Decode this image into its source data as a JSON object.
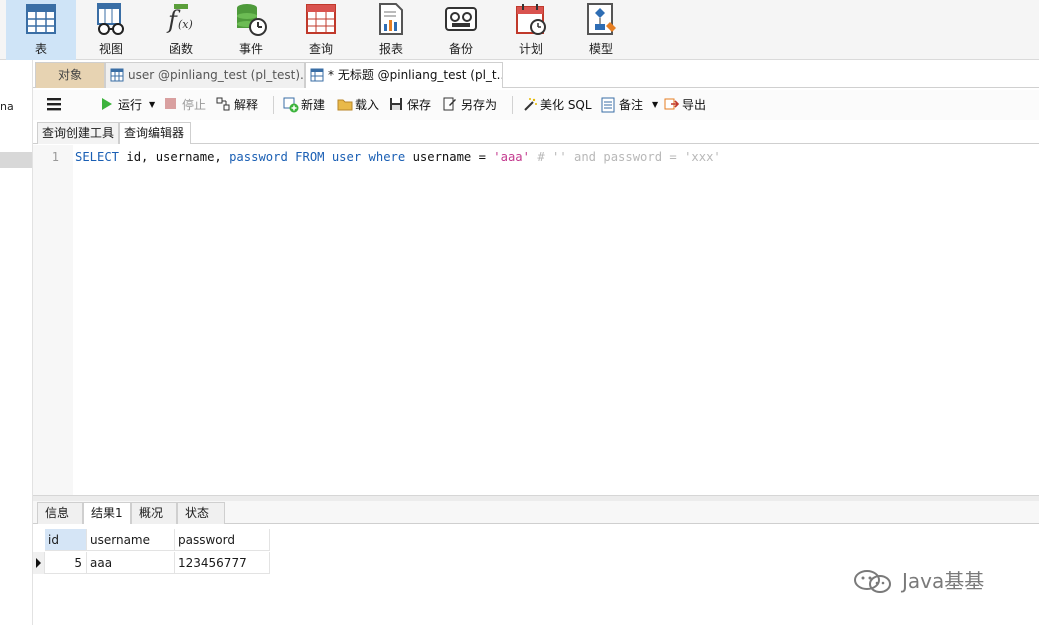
{
  "ribbon": {
    "items": [
      {
        "label": "表",
        "icon": "table-icon"
      },
      {
        "label": "视图",
        "icon": "view-icon"
      },
      {
        "label": "函数",
        "icon": "function-icon"
      },
      {
        "label": "事件",
        "icon": "event-icon"
      },
      {
        "label": "查询",
        "icon": "query-icon"
      },
      {
        "label": "报表",
        "icon": "report-icon"
      },
      {
        "label": "备份",
        "icon": "backup-icon"
      },
      {
        "label": "计划",
        "icon": "schedule-icon"
      },
      {
        "label": "模型",
        "icon": "model-icon"
      }
    ],
    "active_label": "表"
  },
  "left_panel": {
    "fragment_text": "na"
  },
  "doc_tabs": {
    "objects": "对象",
    "tab1": "user @pinliang_test (pl_test)...",
    "tab2": "* 无标题 @pinliang_test (pl_t..."
  },
  "toolbar": {
    "run": "运行",
    "stop": "停止",
    "explain": "解释",
    "new": "新建",
    "load": "载入",
    "save": "保存",
    "save_as": "另存为",
    "beautify": "美化 SQL",
    "note": "备注",
    "export": "导出"
  },
  "sub_tabs": {
    "builder": "查询创建工具",
    "editor": "查询编辑器"
  },
  "editor": {
    "line_number": "1",
    "tokens": [
      {
        "t": "SELECT",
        "c": "kw"
      },
      {
        "t": " id, username, ",
        "c": ""
      },
      {
        "t": "password",
        "c": "kw"
      },
      {
        "t": " ",
        "c": ""
      },
      {
        "t": "FROM",
        "c": "kw"
      },
      {
        "t": " ",
        "c": ""
      },
      {
        "t": "user",
        "c": "kw"
      },
      {
        "t": " ",
        "c": ""
      },
      {
        "t": "where",
        "c": "kw"
      },
      {
        "t": " username = ",
        "c": ""
      },
      {
        "t": "'aaa'",
        "c": "str"
      },
      {
        "t": " # '' and password = 'xxx'",
        "c": "cmt"
      }
    ]
  },
  "result_tabs": {
    "info": "信息",
    "result1": "结果1",
    "overview": "概况",
    "status": "状态"
  },
  "grid": {
    "columns": [
      "id",
      "username",
      "password"
    ],
    "rows": [
      [
        "5",
        "aaa",
        "123456777"
      ]
    ]
  },
  "watermark": {
    "text": "Java基基"
  },
  "colors": {
    "keyword": "#1a5fb4",
    "string": "#c43b8f",
    "comment": "#b8b8b8",
    "ribbon_active": "#cfe4f7",
    "objects_tab": "#e7d3b2"
  }
}
